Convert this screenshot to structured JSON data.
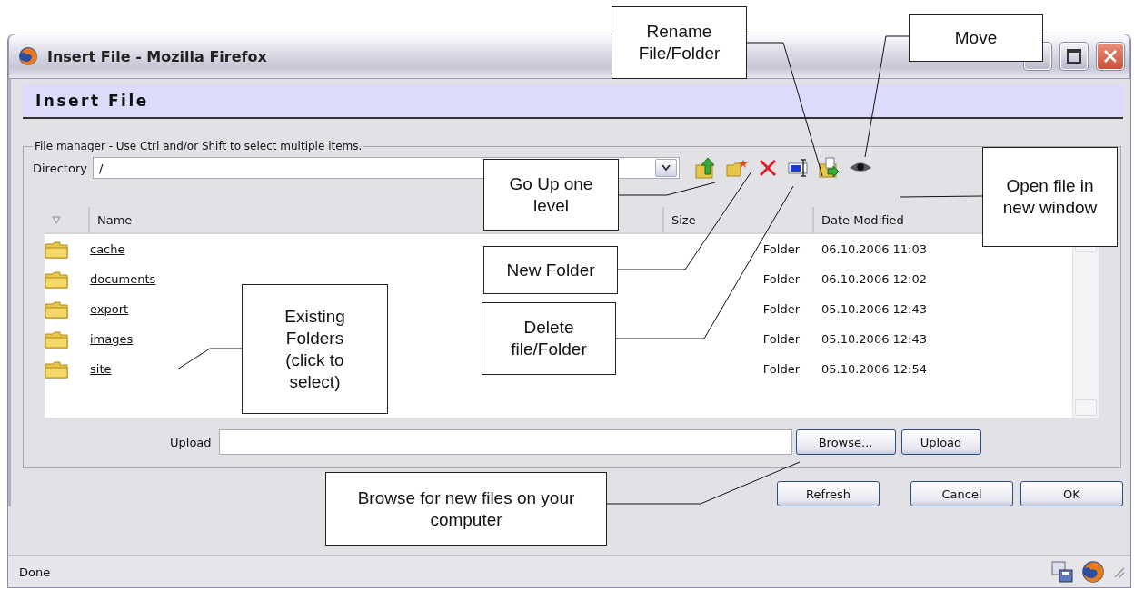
{
  "window": {
    "title": "Insert File - Mozilla Firefox"
  },
  "dialog": {
    "title": "Insert File"
  },
  "file_manager": {
    "legend": "File manager - Use Ctrl and/or Shift to select multiple items.",
    "directory": {
      "label": "Directory",
      "value": "/"
    },
    "toolbar": [
      {
        "kind": "up"
      },
      {
        "kind": "newfolder"
      },
      {
        "kind": "delete"
      },
      {
        "kind": "rename"
      },
      {
        "kind": "move"
      },
      {
        "kind": "view"
      }
    ],
    "table": {
      "columns": [
        "Name",
        "Size",
        "Date Modified"
      ],
      "rows": [
        {
          "name": "cache",
          "size": "Folder",
          "date": "06.10.2006 11:03"
        },
        {
          "name": "documents",
          "size": "Folder",
          "date": "06.10.2006 12:02"
        },
        {
          "name": "export",
          "size": "Folder",
          "date": "05.10.2006 12:43"
        },
        {
          "name": "images",
          "size": "Folder",
          "date": "05.10.2006 12:43"
        },
        {
          "name": "site",
          "size": "Folder",
          "date": "05.10.2006 12:54"
        }
      ]
    },
    "upload": {
      "label": "Upload",
      "browse": "Browse...",
      "button": "Upload"
    }
  },
  "buttons": [
    "Refresh",
    "Cancel",
    "OK"
  ],
  "status_bar": {
    "text": "Done"
  },
  "callouts": [
    {
      "text": "Rename File/Folder"
    },
    {
      "text": "Move"
    },
    {
      "text": "Go Up one level"
    },
    {
      "text": "Open file in new window"
    },
    {
      "text": "New Folder"
    },
    {
      "text": "Existing Folders (click to select)"
    },
    {
      "text": "Delete file/Folder"
    },
    {
      "text": "Browse for new files on your computer"
    }
  ]
}
